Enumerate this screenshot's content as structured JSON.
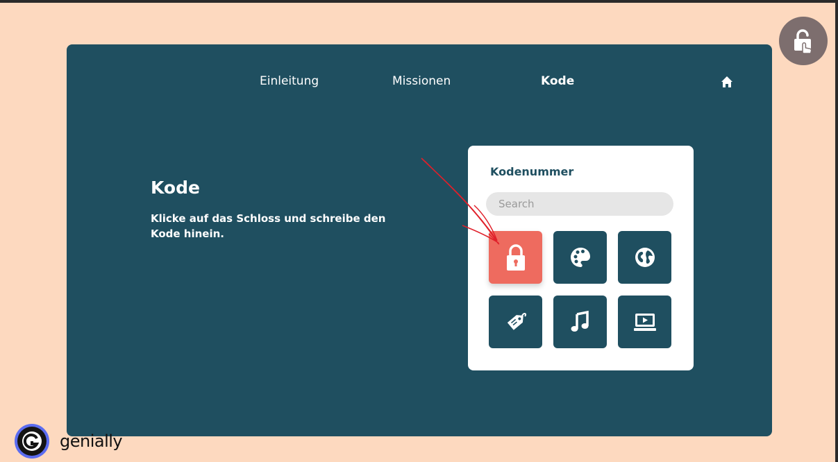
{
  "nav": {
    "items": [
      {
        "label": "Einleitung",
        "active": false
      },
      {
        "label": "Missionen",
        "active": false
      },
      {
        "label": "Kode",
        "active": true
      }
    ],
    "home_icon": "home-icon"
  },
  "fab": {
    "icon": "unlock-hand-icon"
  },
  "content": {
    "title": "Kode",
    "description": "Klicke auf das Schloss und schreibe den Kode hinein."
  },
  "card": {
    "title": "Kodenummer",
    "search_placeholder": "Search",
    "tiles": [
      {
        "icon": "padlock-icon",
        "highlighted": true
      },
      {
        "icon": "palette-icon",
        "highlighted": false
      },
      {
        "icon": "globe-icon",
        "highlighted": false
      },
      {
        "icon": "price-tag-icon",
        "highlighted": false
      },
      {
        "icon": "music-note-icon",
        "highlighted": false
      },
      {
        "icon": "video-player-icon",
        "highlighted": false
      }
    ]
  },
  "brand": {
    "name": "genially"
  },
  "colors": {
    "page_background": "#fdd9bf",
    "panel": "#1f4f60",
    "highlight_tile": "#ee6b5f",
    "fab": "#7d6e6e",
    "annotation": "#e0202a"
  }
}
